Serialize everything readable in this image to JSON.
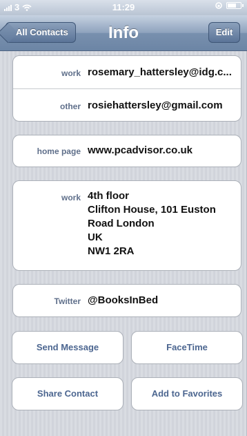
{
  "status_bar": {
    "carrier": "3",
    "time": "11:29"
  },
  "nav": {
    "back_label": "All Contacts",
    "title": "Info",
    "edit_label": "Edit"
  },
  "emails": [
    {
      "label": "work",
      "value": "rosemary_hattersley@idg.c..."
    },
    {
      "label": "other",
      "value": "rosiehattersley@gmail.com"
    }
  ],
  "homepage": {
    "label": "home page",
    "value": "www.pcadvisor.co.uk"
  },
  "address": {
    "label": "work",
    "lines": [
      "4th floor",
      "Clifton House, 101 Euston",
      "Road London",
      "UK",
      "NW1 2RA"
    ]
  },
  "twitter": {
    "label": "Twitter",
    "value": "@BooksInBed"
  },
  "actions": {
    "send_message": "Send Message",
    "facetime": "FaceTime",
    "share_contact": "Share Contact",
    "add_to_favorites": "Add to Favorites"
  }
}
